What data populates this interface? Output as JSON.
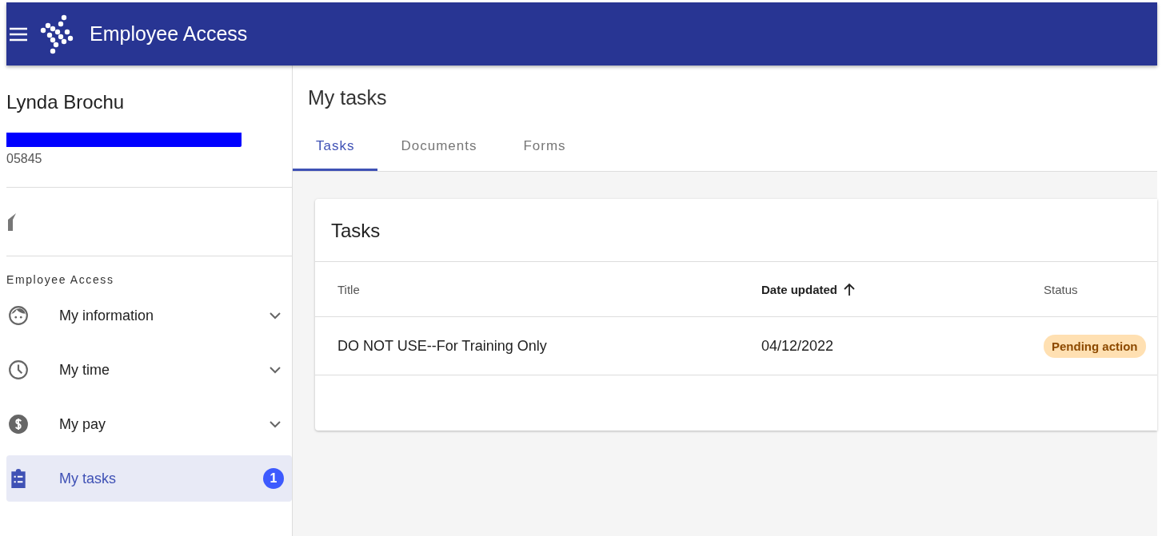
{
  "app_bar": {
    "title": "Employee Access"
  },
  "profile": {
    "name": "Lynda Brochu",
    "number": "05845"
  },
  "sidebar": {
    "section_title": "Employee Access",
    "items": [
      {
        "label": "My information",
        "kind": "face",
        "selected": false,
        "expandable": true
      },
      {
        "label": "My time",
        "kind": "clock",
        "selected": false,
        "expandable": true
      },
      {
        "label": "My pay",
        "kind": "money",
        "selected": false,
        "expandable": true
      },
      {
        "label": "My tasks",
        "kind": "tasks",
        "selected": true,
        "expandable": false,
        "badge": "1"
      }
    ]
  },
  "page": {
    "title": "My tasks",
    "tabs": [
      {
        "label": "Tasks",
        "selected": true
      },
      {
        "label": "Documents",
        "selected": false
      },
      {
        "label": "Forms",
        "selected": false
      }
    ]
  },
  "card": {
    "title": "Tasks",
    "table": {
      "columns": [
        {
          "label": "Title",
          "sorted": false
        },
        {
          "label": "Date updated",
          "sorted": true
        },
        {
          "label": "Status",
          "sorted": false
        }
      ],
      "rows": [
        {
          "title": "DO NOT USE--For Training Only",
          "date_updated": "04/12/2022",
          "status": "Pending action"
        }
      ]
    }
  }
}
